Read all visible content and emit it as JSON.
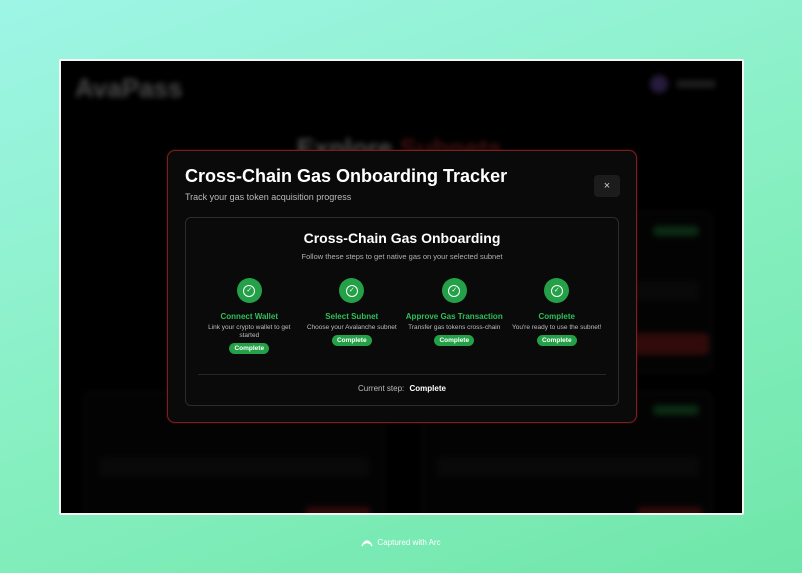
{
  "background_app": {
    "logo": "AvaPass",
    "hero_title": "Explore",
    "hero_title_accent": "Subnets"
  },
  "modal": {
    "title": "Cross-Chain Gas Onboarding Tracker",
    "subtitle": "Track your gas token acquisition progress",
    "close_label": "×"
  },
  "panel": {
    "title": "Cross-Chain Gas Onboarding",
    "subtitle": "Follow these steps to get native gas on your selected subnet",
    "steps": [
      {
        "label": "Connect Wallet",
        "description": "Link your crypto wallet to get started",
        "status": "Complete"
      },
      {
        "label": "Select Subnet",
        "description": "Choose your Avalanche subnet",
        "status": "Complete"
      },
      {
        "label": "Approve Gas Transaction",
        "description": "Transfer gas tokens cross-chain",
        "status": "Complete"
      },
      {
        "label": "Complete",
        "description": "You're ready to use the subnet!",
        "status": "Complete"
      }
    ],
    "current_step_label": "Current step:",
    "current_step_value": "Complete"
  },
  "footer": {
    "captured_text": "Captured with Arc"
  },
  "colors": {
    "accent_green": "#24a148",
    "modal_border": "#7a2020",
    "background_gradient_start": "#9ef5e6",
    "background_gradient_end": "#6fe6a9"
  }
}
